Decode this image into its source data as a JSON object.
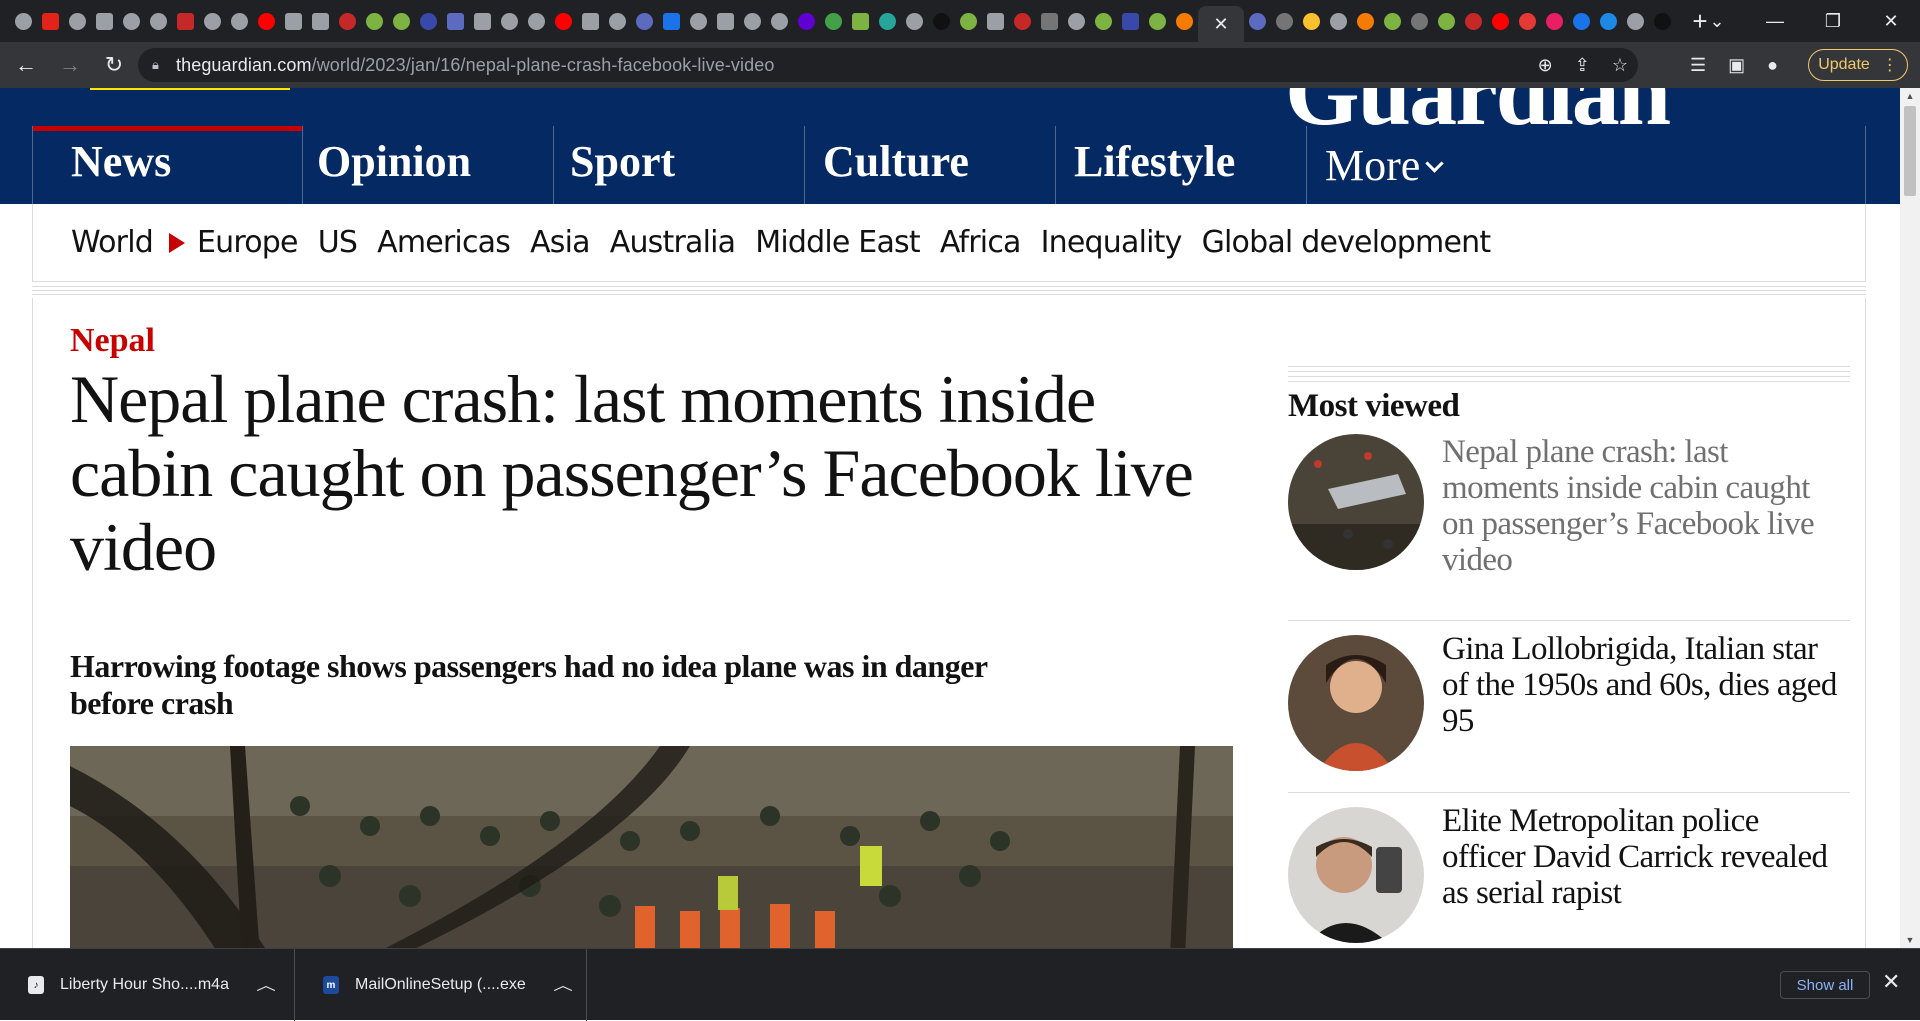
{
  "browser": {
    "active_tab_close": "✕",
    "new_tab": "+",
    "tab_search": "⌄",
    "window": {
      "minimize": "—",
      "restore": "❐",
      "close": "✕"
    },
    "url_host": "theguardian.com",
    "url_path": "/world/2023/jan/16/nepal-plane-crash-facebook-live-video",
    "update_label": "Update"
  },
  "site": {
    "pillars": [
      "News",
      "Opinion",
      "Sport",
      "Culture",
      "Lifestyle"
    ],
    "more_label": "More",
    "subnav": {
      "current": "World",
      "items": [
        "Europe",
        "US",
        "Americas",
        "Asia",
        "Australia",
        "Middle East",
        "Africa",
        "Inequality",
        "Global development"
      ]
    }
  },
  "article": {
    "kicker": "Nepal",
    "headline": "Nepal plane crash: last moments inside cabin caught on passenger’s Facebook live video",
    "standfirst": "Harrowing footage shows passengers had no idea plane was in danger before crash"
  },
  "most_viewed": {
    "title": "Most viewed",
    "items": [
      {
        "title": "Nepal plane crash: last moments inside cabin caught on passenger’s Facebook live video"
      },
      {
        "title": "Gina Lollobrigida, Italian star of the 1950s and 60s, dies aged 95"
      },
      {
        "title": "Elite Metropolitan police officer David Carrick revealed as serial rapist"
      }
    ]
  },
  "downloads": {
    "items": [
      {
        "name": "Liberty Hour Sho....m4a"
      },
      {
        "name": "MailOnlineSetup (....exe"
      }
    ],
    "show_all": "Show all",
    "close": "✕"
  },
  "colors": {
    "guardian_blue": "#052962",
    "guardian_red": "#c70000",
    "browser_dark": "#202124",
    "update_accent": "#f0c96a"
  }
}
